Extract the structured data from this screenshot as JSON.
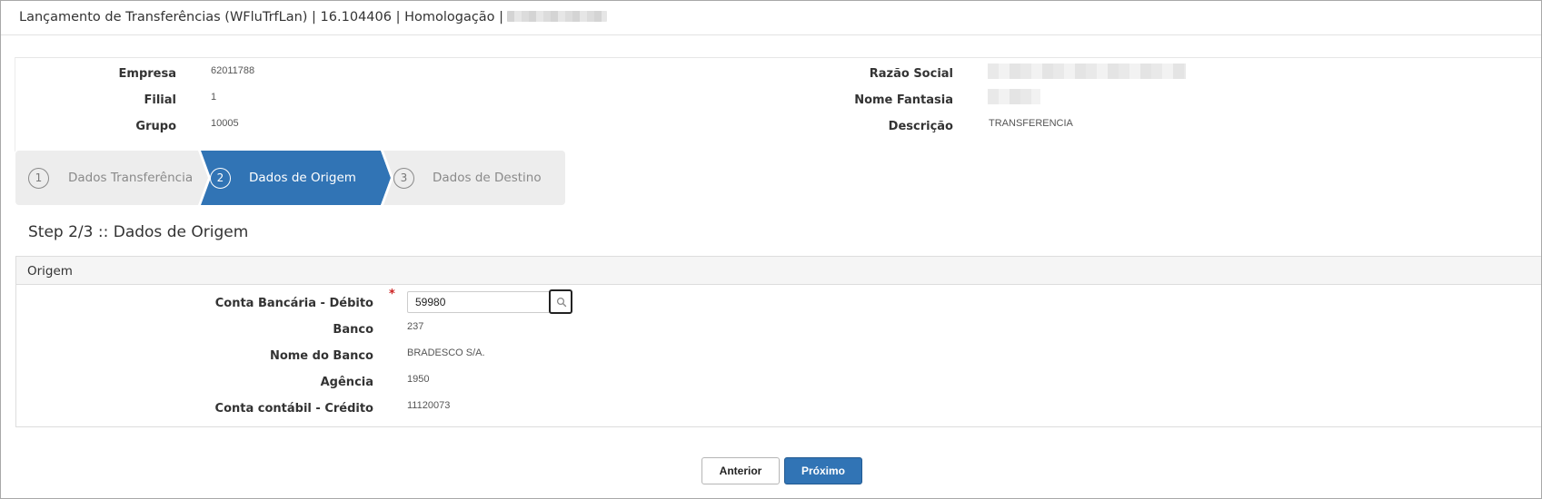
{
  "window": {
    "title": "Lançamento de Transferências (WFluTrfLan) | 16.104406 | Homologação |"
  },
  "header": {
    "fields_left": [
      {
        "label": "Empresa",
        "value": "62011788"
      },
      {
        "label": "Filial",
        "value": "1"
      },
      {
        "label": "Grupo",
        "value": "10005"
      }
    ],
    "fields_right": [
      {
        "label": "Razão Social",
        "value": ""
      },
      {
        "label": "Nome Fantasia",
        "value": ""
      },
      {
        "label": "Descrição",
        "value": "TRANSFERENCIA"
      }
    ]
  },
  "wizard": {
    "steps": [
      {
        "number": "1",
        "label": "Dados Transferência",
        "state": "done"
      },
      {
        "number": "2",
        "label": "Dados de Origem",
        "state": "active"
      },
      {
        "number": "3",
        "label": "Dados de Destino",
        "state": "pending"
      }
    ],
    "active_color": "#3174b5"
  },
  "step_heading": "Step 2/3 :: Dados de Origem",
  "origem": {
    "title": "Origem",
    "conta_bancaria": {
      "label": "Conta Bancária - Débito",
      "value": "59980",
      "required": true
    },
    "fields": [
      {
        "label": "Banco",
        "value": "237"
      },
      {
        "label": "Nome do Banco",
        "value": "BRADESCO S/A."
      },
      {
        "label": "Agência",
        "value": "1950"
      },
      {
        "label": "Conta contábil - Crédito",
        "value": "11120073"
      }
    ],
    "lookup_icon": "search-icon"
  },
  "buttons": {
    "anterior": "Anterior",
    "proximo": "Próximo"
  }
}
